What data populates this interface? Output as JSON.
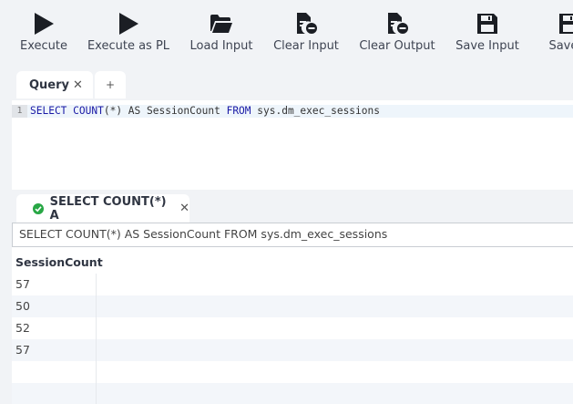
{
  "toolbar": {
    "buttons": [
      {
        "label": "Execute",
        "icon": "play-icon"
      },
      {
        "label": "Execute as PL",
        "icon": "play-icon"
      },
      {
        "label": "Load Input",
        "icon": "folder-open-icon"
      },
      {
        "label": "Clear Input",
        "icon": "file-remove-icon"
      },
      {
        "label": "Clear Output",
        "icon": "file-remove-icon"
      },
      {
        "label": "Save Input",
        "icon": "floppy-disk-icon"
      },
      {
        "label": "Save C",
        "icon": "floppy-disk-icon"
      }
    ]
  },
  "editor": {
    "tabs": [
      {
        "label": "Query",
        "close": "✕"
      }
    ],
    "add_tab": "+",
    "line_number": "1",
    "code": {
      "kw1": "SELECT",
      "kw2": "COUNT",
      "mid": "(*) AS SessionCount ",
      "kw3": "FROM",
      "rest": " sys.dm_exec_sessions"
    }
  },
  "result": {
    "tab_label": "SELECT COUNT(*) A",
    "tab_close": "✕",
    "status_color": "#28a745",
    "query_text": "SELECT COUNT(*) AS SessionCount FROM sys.dm_exec_sessions",
    "columns": [
      "SessionCount"
    ],
    "rows": [
      [
        "57"
      ],
      [
        "50"
      ],
      [
        "52"
      ],
      [
        "57"
      ],
      [
        ""
      ],
      [
        ""
      ]
    ]
  }
}
